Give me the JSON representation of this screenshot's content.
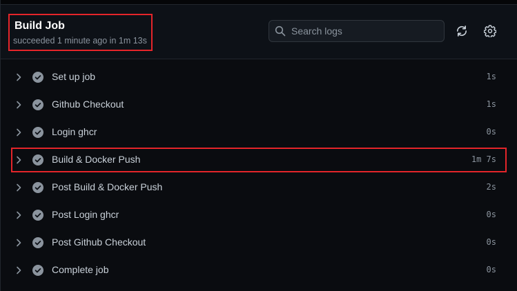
{
  "header": {
    "title": "Build Job",
    "subtitle": "succeeded 1 minute ago in 1m 13s",
    "search": {
      "placeholder": "Search logs",
      "value": ""
    }
  },
  "icons": {
    "search": "search-icon",
    "refresh": "refresh-icon",
    "settings": "gear-icon",
    "chevron": "chevron-right-icon",
    "status": "check-circle-icon"
  },
  "colors": {
    "highlight": "#e5252a",
    "check": "#8b949e",
    "background": "#0d1117"
  },
  "steps": [
    {
      "name": "Set up job",
      "time": "1s",
      "status": "success"
    },
    {
      "name": "Github Checkout",
      "time": "1s",
      "status": "success"
    },
    {
      "name": "Login ghcr",
      "time": "0s",
      "status": "success"
    },
    {
      "name": "Build & Docker Push",
      "time": "1m 7s",
      "status": "success",
      "highlighted": true
    },
    {
      "name": "Post Build & Docker Push",
      "time": "2s",
      "status": "success"
    },
    {
      "name": "Post Login ghcr",
      "time": "0s",
      "status": "success"
    },
    {
      "name": "Post Github Checkout",
      "time": "0s",
      "status": "success"
    },
    {
      "name": "Complete job",
      "time": "0s",
      "status": "success"
    }
  ]
}
